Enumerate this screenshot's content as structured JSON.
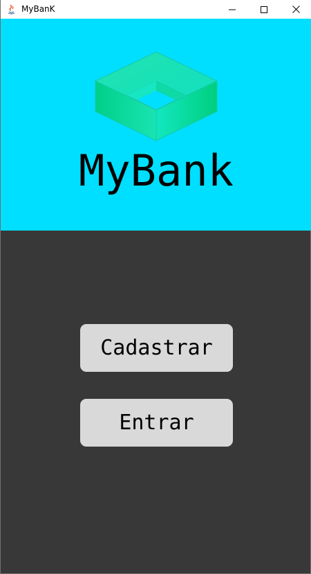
{
  "window": {
    "title": "MyBanK",
    "controls": {
      "minimize_icon": "minimize-icon",
      "maximize_icon": "maximize-icon",
      "close_icon": "close-icon"
    }
  },
  "brand": {
    "name": "MyBank",
    "logo_icon": "cube-ring-logo",
    "panel_color": "#00dfff"
  },
  "actions": {
    "register_label": "Cadastrar",
    "login_label": "Entrar"
  },
  "colors": {
    "background": "#383838",
    "button": "#d9d9d9",
    "logo_green": "#00d98a",
    "logo_teal": "#1de9c4"
  }
}
